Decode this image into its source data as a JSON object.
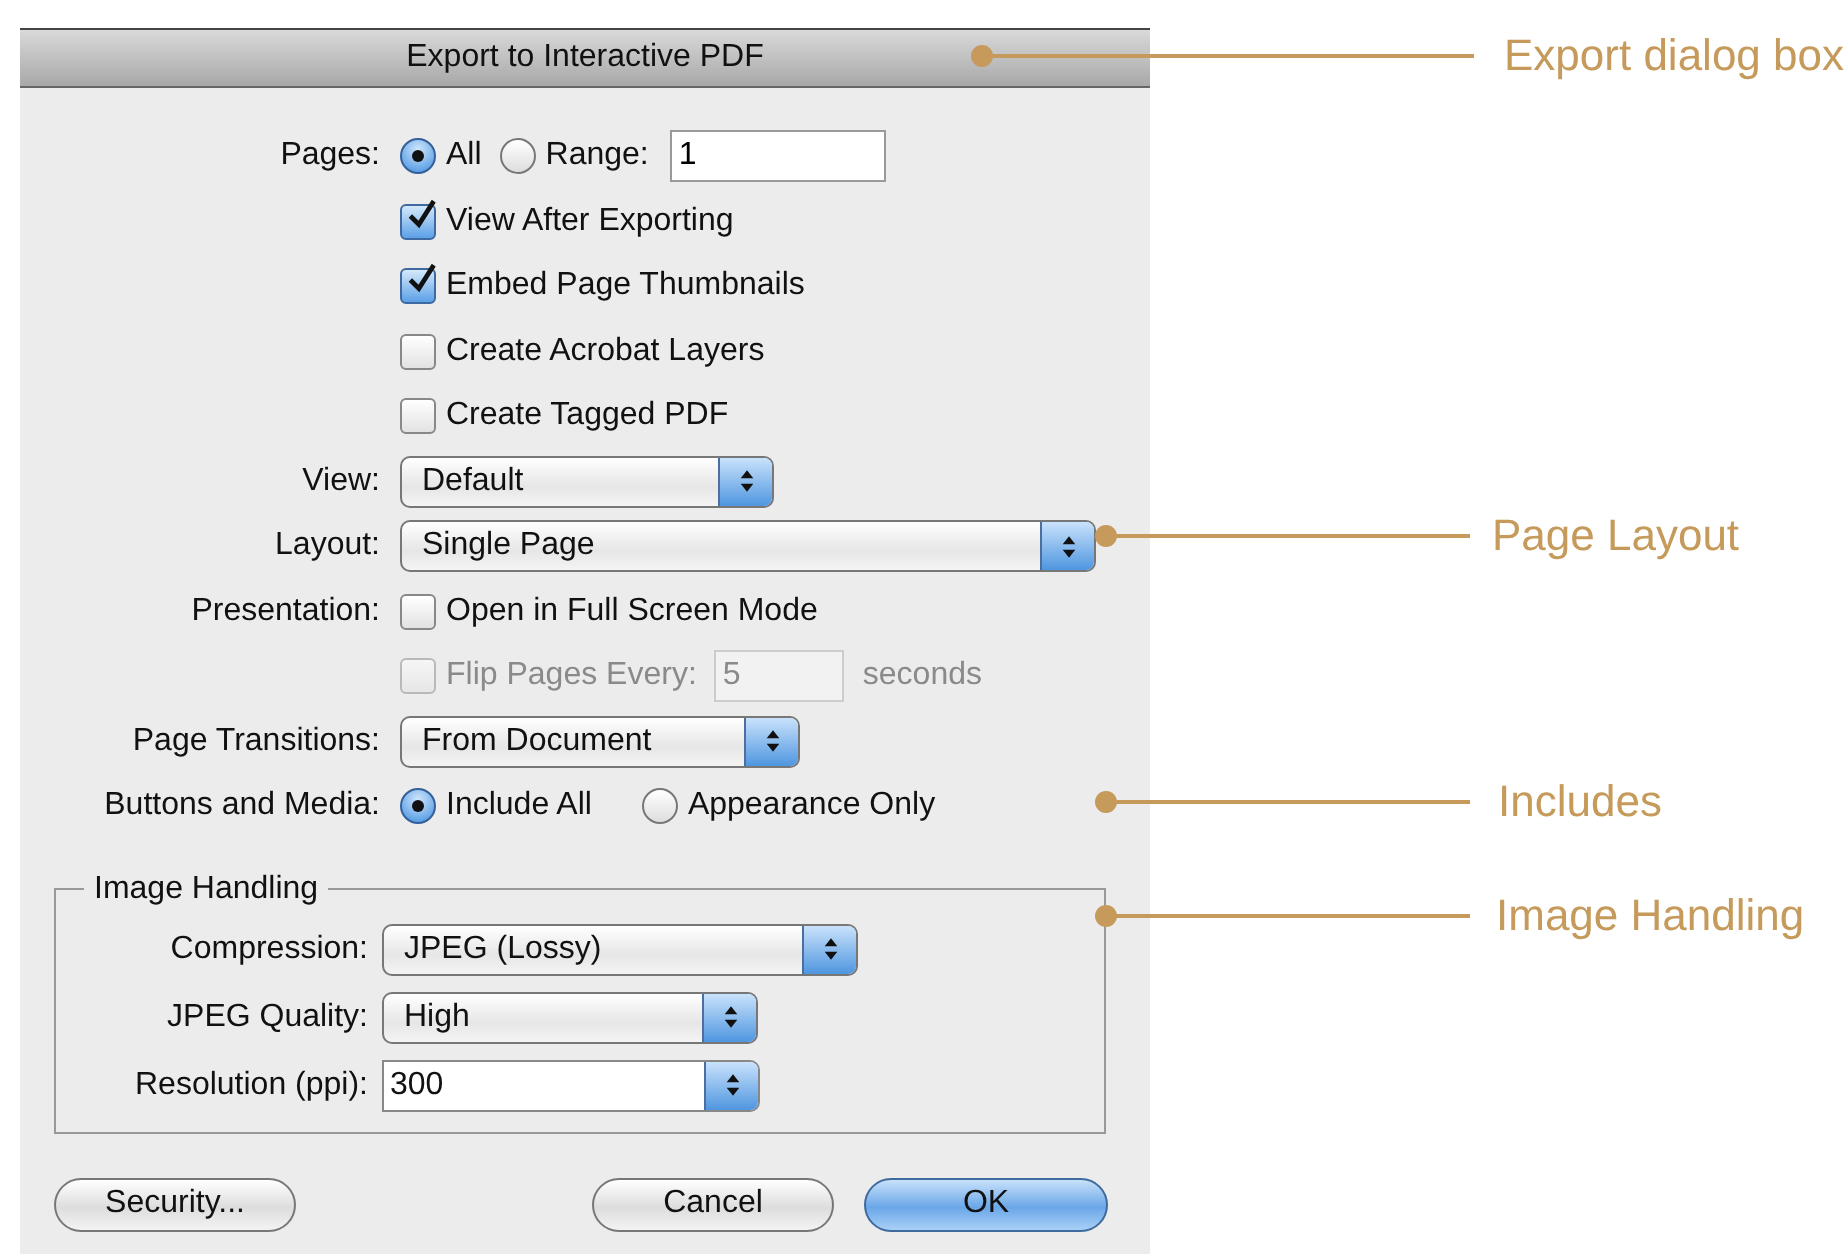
{
  "dialog": {
    "title": "Export to Interactive PDF",
    "pages": {
      "label": "Pages:",
      "options": [
        {
          "label": "All",
          "selected": true
        },
        {
          "label": "Range:",
          "selected": false
        }
      ],
      "range_value": "1"
    },
    "checkboxes": [
      {
        "label": "View After Exporting",
        "checked": true
      },
      {
        "label": "Embed Page Thumbnails",
        "checked": true
      },
      {
        "label": "Create Acrobat Layers",
        "checked": false
      },
      {
        "label": "Create Tagged PDF",
        "checked": false
      }
    ],
    "view": {
      "label": "View:",
      "value": "Default"
    },
    "layout": {
      "label": "Layout:",
      "value": "Single Page"
    },
    "presentation": {
      "label": "Presentation:",
      "full_screen": {
        "label": "Open in Full Screen Mode",
        "checked": false
      },
      "flip": {
        "label": "Flip Pages Every:",
        "checked": false,
        "disabled": true,
        "value": "5",
        "unit": "seconds"
      }
    },
    "page_transitions": {
      "label": "Page Transitions:",
      "value": "From Document"
    },
    "buttons_and_media": {
      "label": "Buttons and Media:",
      "options": [
        {
          "label": "Include All",
          "selected": true
        },
        {
          "label": "Appearance Only",
          "selected": false
        }
      ]
    },
    "image_handling": {
      "title": "Image Handling",
      "fields": [
        {
          "label": "Compression:",
          "value": "JPEG (Lossy)",
          "kind": "select"
        },
        {
          "label": "JPEG Quality:",
          "value": "High",
          "kind": "select"
        },
        {
          "label": "Resolution (ppi):",
          "value": "300",
          "kind": "combo"
        }
      ]
    },
    "buttons": [
      {
        "label": "Security...",
        "kind": "normal"
      },
      {
        "label": "Cancel",
        "kind": "normal"
      },
      {
        "label": "OK",
        "kind": "default"
      }
    ]
  },
  "callouts": [
    {
      "label": "Export dialog box"
    },
    {
      "label": "Page Layout"
    },
    {
      "label": "Includes"
    },
    {
      "label": "Image Handling"
    }
  ]
}
